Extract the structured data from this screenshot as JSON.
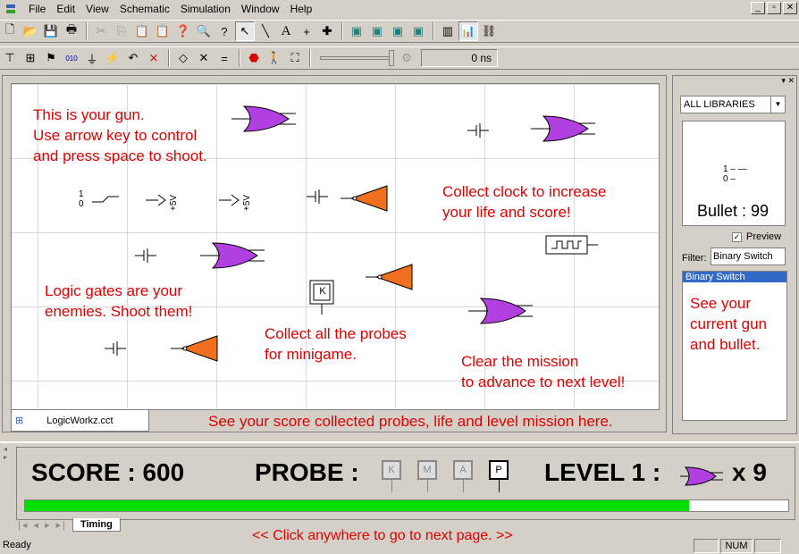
{
  "menu": [
    "File",
    "Edit",
    "View",
    "Schematic",
    "Simulation",
    "Window",
    "Help"
  ],
  "toolbar2": {
    "time": "0 ns"
  },
  "canvas": {
    "text1": [
      "This is your gun.",
      "Use arrow key to control",
      "and press space to shoot."
    ],
    "text2": [
      "Collect clock to increase",
      "your life and score!"
    ],
    "text3": [
      "Logic gates are your",
      "enemies. Shoot them!"
    ],
    "text4": [
      "Collect all the probes",
      "for minigame."
    ],
    "text5": [
      "Clear the mission",
      "to advance to next level!"
    ],
    "vcc_label": "+5V",
    "probe_k": "K",
    "switch_one": "1",
    "switch_zero": "0"
  },
  "tab": {
    "label": "LogicWorkz.cct"
  },
  "hint_score": "See your score collected probes, life and level mission here.",
  "sidebar": {
    "library": "ALL LIBRARIES",
    "bullet": "Bullet : 99",
    "preview": "Preview",
    "filter_label": "Filter:",
    "filter_value": "Binary Switch",
    "selected": "Binary Switch",
    "hint": [
      "See your",
      "current gun",
      "and bullet."
    ],
    "one": "1",
    "zero": "0"
  },
  "panel": {
    "score": "SCORE : 600",
    "probe_label": "PROBE :",
    "probes": [
      "K",
      "M",
      "A",
      "P"
    ],
    "level": "LEVEL 1 :",
    "lives": "x 9",
    "progress": 0.87,
    "tab": "Timing"
  },
  "footer_hint": "<< Click anywhere to go to next page. >>",
  "status": {
    "ready": "Ready",
    "num": "NUM"
  },
  "colors": {
    "gate": "#b040e0",
    "triangle": "#f07020",
    "accent": "#e00000",
    "progress": "#00e000"
  }
}
